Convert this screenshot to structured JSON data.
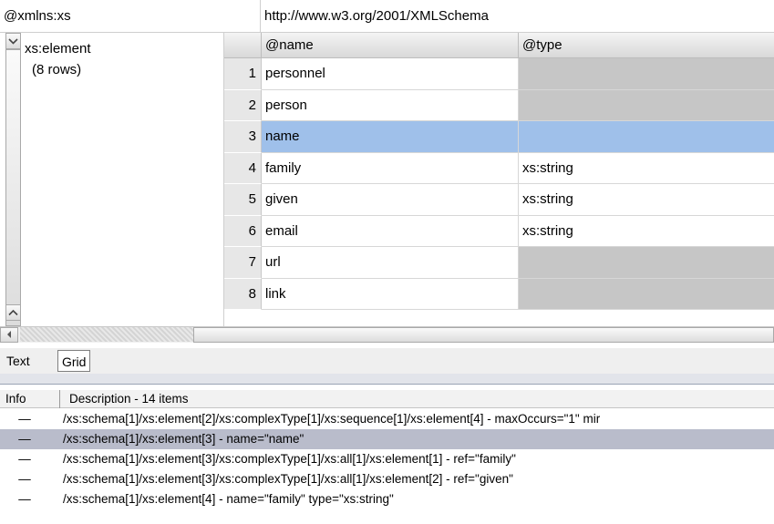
{
  "attribute": {
    "name": "@xmlns:xs",
    "value": "http://www.w3.org/2001/XMLSchema"
  },
  "element": {
    "toggle_icon": "collapse-chevron-icon",
    "name": "xs:element",
    "row_count": "(8 rows)"
  },
  "grid": {
    "columns": [
      "@name",
      "@type"
    ],
    "selected_row": 3,
    "rows": [
      {
        "num": "1",
        "name": "personnel",
        "type": ""
      },
      {
        "num": "2",
        "name": "person",
        "type": ""
      },
      {
        "num": "3",
        "name": "name",
        "type": ""
      },
      {
        "num": "4",
        "name": "family",
        "type": "xs:string"
      },
      {
        "num": "5",
        "name": "given",
        "type": "xs:string"
      },
      {
        "num": "6",
        "name": "email",
        "type": "xs:string"
      },
      {
        "num": "7",
        "name": "url",
        "type": ""
      },
      {
        "num": "8",
        "name": "link",
        "type": ""
      }
    ]
  },
  "view_tabs": [
    "Text",
    "Grid"
  ],
  "messages": {
    "headers": {
      "info": "Info",
      "description": "Description - 14 items"
    },
    "items": [
      {
        "info": "—",
        "text": "/xs:schema[1]/xs:element[2]/xs:complexType[1]/xs:sequence[1]/xs:element[4] - maxOccurs=\"1\" mir"
      },
      {
        "info": "—",
        "text": "/xs:schema[1]/xs:element[3] - name=\"name\""
      },
      {
        "info": "—",
        "text": "/xs:schema[1]/xs:element[3]/xs:complexType[1]/xs:all[1]/xs:element[1] - ref=\"family\""
      },
      {
        "info": "—",
        "text": "/xs:schema[1]/xs:element[3]/xs:complexType[1]/xs:all[1]/xs:element[2] - ref=\"given\""
      },
      {
        "info": "—",
        "text": "/xs:schema[1]/xs:element[4] - name=\"family\" type=\"xs:string\""
      }
    ]
  },
  "colors": {
    "selection": "#9fc0ea",
    "empty_cell": "#c6c6c6",
    "message_highlight": "#b9bccb"
  }
}
